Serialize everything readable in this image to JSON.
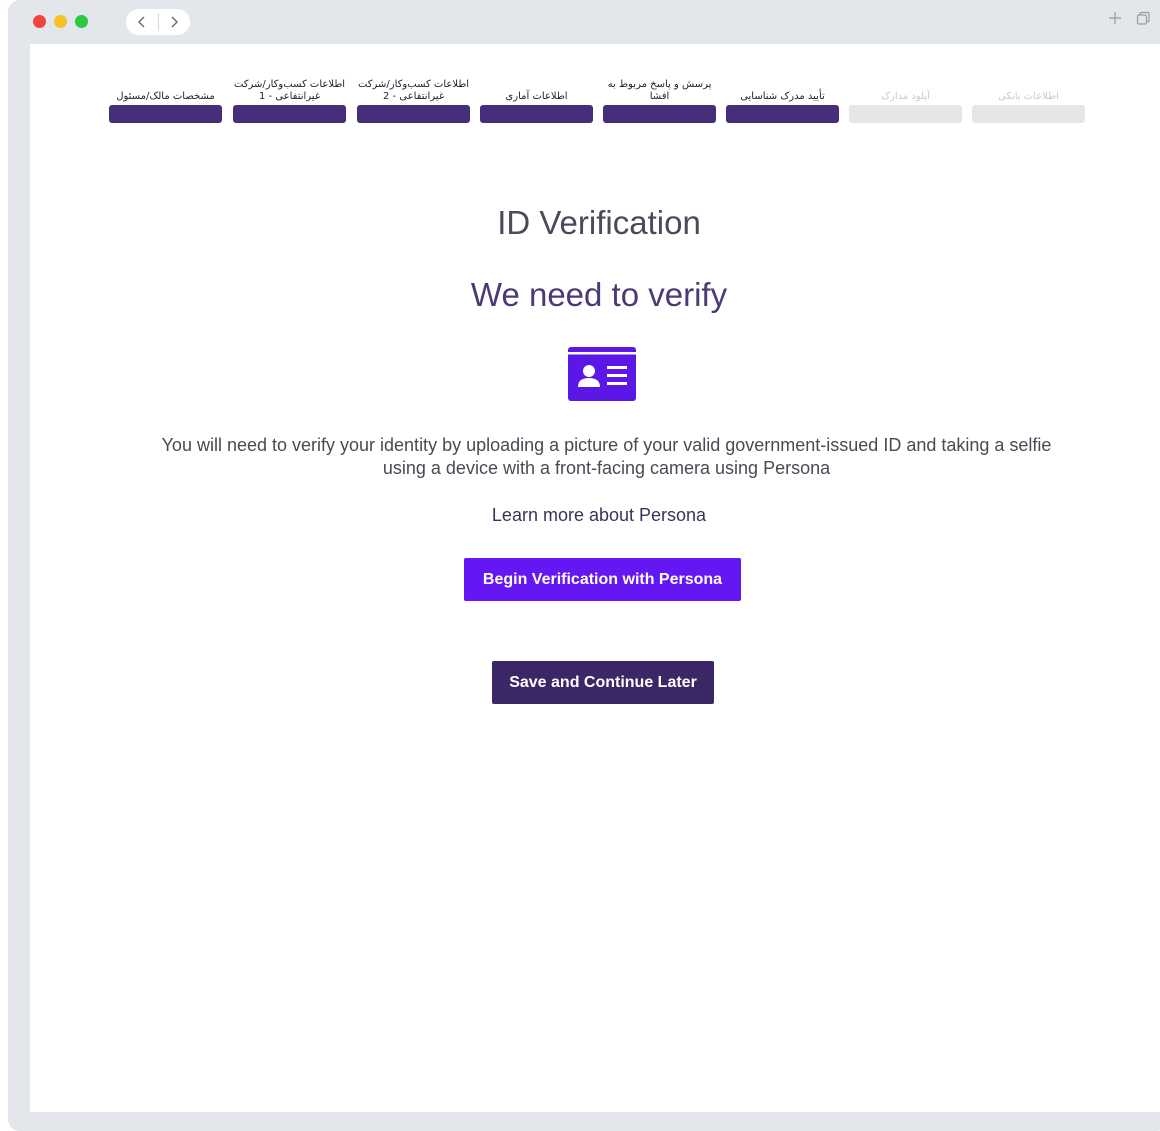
{
  "browser": {
    "back_icon": "chevron-left-icon",
    "forward_icon": "chevron-right-icon",
    "new_tab_icon": "plus-icon",
    "tabs_icon": "tabs-icon"
  },
  "stepper": {
    "steps": [
      {
        "label": "مشخصات مالک/مسئول",
        "state": "completed"
      },
      {
        "label": "اطلاعات کسب‌وکار/شرکت غیرانتفاعی - 1",
        "state": "completed"
      },
      {
        "label": "اطلاعات کسب‌وکار/شرکت غیرانتفاعی - 2",
        "state": "completed"
      },
      {
        "label": "اطلاعات آماری",
        "state": "completed"
      },
      {
        "label": "پرسش و پاسخ مربوط به افشا",
        "state": "completed"
      },
      {
        "label": "تأیید مدرک شناسایی",
        "state": "current"
      },
      {
        "label": "آپلود مدارک",
        "state": "upcoming"
      },
      {
        "label": "اطلاعات بانکی",
        "state": "upcoming"
      }
    ],
    "completed_color": "#472e7b",
    "upcoming_color": "#e6e6e8"
  },
  "main": {
    "title": "ID Verification",
    "subtitle": "We need to verify",
    "icon": "id-card-icon",
    "icon_color": "#5b17e6",
    "description": "You will need to verify your identity by uploading a picture of your valid government-issued ID and taking a selfie using a device with a front-facing camera using Persona",
    "learn_more": "Learn more about Persona",
    "begin_button": "Begin Verification with Persona",
    "save_button": "Save and Continue Later",
    "primary_color": "#6517f3",
    "secondary_color": "#3c2766"
  }
}
